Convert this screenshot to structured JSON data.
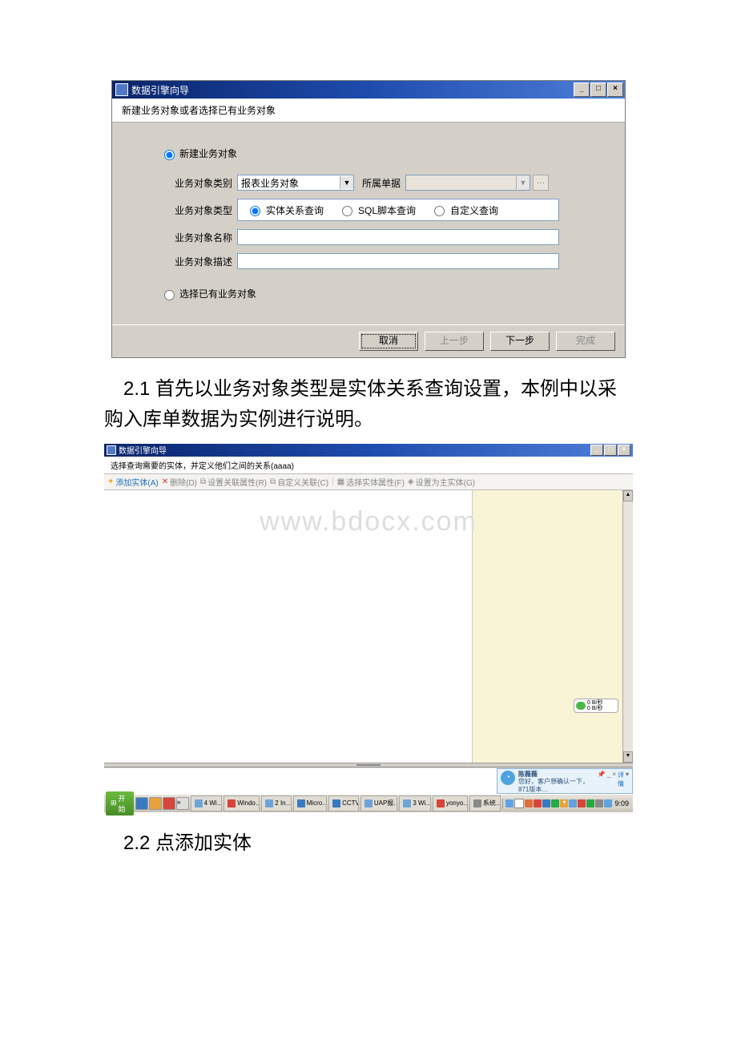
{
  "dialog1": {
    "title": "数据引擎向导",
    "subtitle": "新建业务对象或者选择已有业务对象",
    "radio_new": "新建业务对象",
    "radio_existing": "选择已有业务对象",
    "field_category_label": "业务对象类别",
    "field_category_value": "报表业务对象",
    "field_owner_label": "所属单据",
    "field_type_label": "业务对象类型",
    "type_opt1": "实体关系查询",
    "type_opt2": "SQL脚本查询",
    "type_opt3": "自定义查询",
    "field_name_label": "业务对象名称",
    "field_desc_label": "业务对象描述",
    "btn_cancel": "取消",
    "btn_prev": "上一步",
    "btn_next": "下一步",
    "btn_finish": "完成"
  },
  "para1": "2.1 首先以业务对象类型是实体关系查询设置，本例中以采购入库单数据为实例进行说明。",
  "dialog2": {
    "title": "数据引擎向导",
    "subtitle": "选择查询需要的实体，并定义他们之间的关系(aaaa)",
    "tb_add": "添加实体(A)",
    "tb_del": "删除(D)",
    "tb_relprop": "设置关联属性(R)",
    "tb_custom": "自定义关联(C)",
    "tb_field": "选择实体属性(F)",
    "tb_main": "设置为主实体(G)",
    "popup_l1": "0 B/秒",
    "popup_l2": "0 B/秒",
    "im_name": "陈薇薇",
    "im_msg": "您好，客户想确认一下，871版本…",
    "im_detail": "详情"
  },
  "watermark": "www.bdocx.com",
  "taskbar": {
    "start": "开始",
    "t1": "4 Wi…",
    "t2": "Windo…",
    "t3": "2 In…",
    "t4": "Micro…",
    "t5": "CCTV",
    "t6": "UAP报…",
    "t7": "3 Wi…",
    "t8": "yonyo…",
    "t9": "系统…",
    "clock": "9:09"
  },
  "para2": "2.2 点添加实体"
}
